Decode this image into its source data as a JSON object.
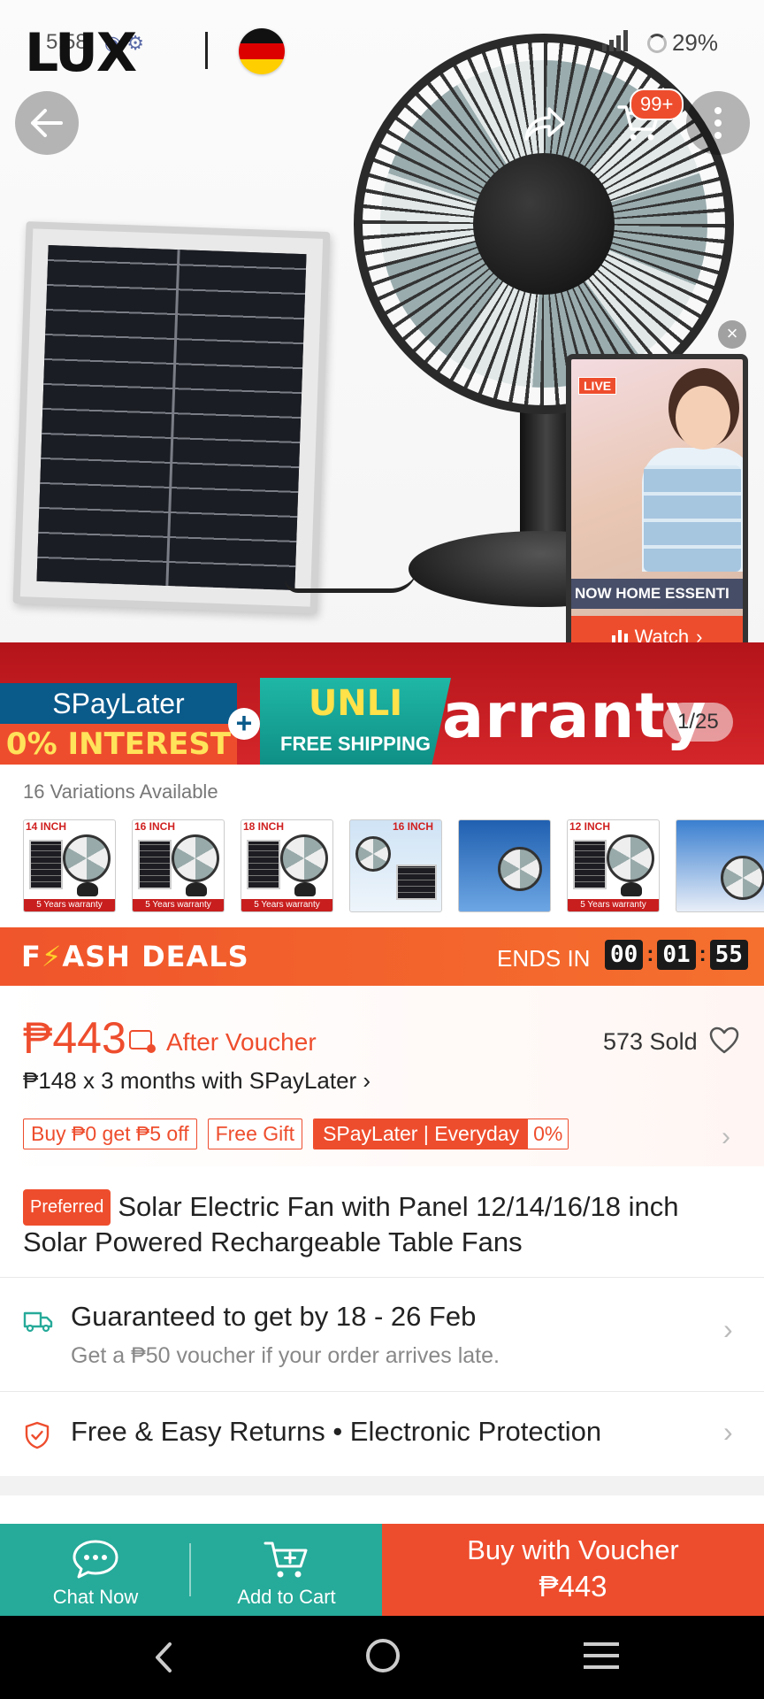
{
  "status_bar": {
    "time": "5:58",
    "battery": "29%"
  },
  "header": {
    "brand_logo": "LUX",
    "cart_badge": "99+",
    "back_icon": "arrow-left-icon",
    "share_icon": "share-icon",
    "cart_icon": "cart-icon",
    "more_icon": "more-vertical-icon"
  },
  "hero": {
    "image_counter": "1/25",
    "promo_spaylater": "SPayLater",
    "promo_interest": "0% INTEREST",
    "promo_unli": "UNLI",
    "promo_free_shipping": "FREE SHIPPING",
    "promo_warranty": "arranty"
  },
  "live": {
    "tag": "LIVE",
    "ticker": "NOW  HOME ESSENTI",
    "watch_label": "Watch"
  },
  "variations": {
    "title": "16 Variations Available",
    "thumbs": [
      {
        "label": "14 INCH",
        "footer": "5 Years warranty"
      },
      {
        "label": "16 INCH",
        "footer": "5 Years warranty"
      },
      {
        "label": "18 INCH",
        "footer": "5 Years warranty"
      },
      {
        "label": "16 INCH",
        "footer": ""
      },
      {
        "label": "",
        "footer": ""
      },
      {
        "label": "12 INCH",
        "footer": "5 Years warranty"
      },
      {
        "label": "",
        "footer": ""
      }
    ]
  },
  "flash": {
    "title_pre": "F",
    "title_post": "ASH DEALS",
    "ends_in": "ENDS IN",
    "hours": "00",
    "minutes": "01",
    "seconds": "55"
  },
  "price": {
    "amount": "₱443",
    "after_voucher": "After Voucher",
    "sold": "573 Sold",
    "installment": "₱148 x 3 months with SPayLater ›",
    "tags": [
      "Buy ₱0 get ₱5 off",
      "Free Gift"
    ],
    "spl_tag_a": "SPayLater | Everyday",
    "spl_tag_b": "0%"
  },
  "product": {
    "badge": "Preferred",
    "title": "Solar Electric Fan with Panel 12/14/16/18 inch Solar Powered Rechargeable Table Fans"
  },
  "delivery": {
    "main": "Guaranteed to get by 18 - 26 Feb",
    "sub": "Get a ₱50 voucher if your order arrives late."
  },
  "returns": {
    "text": "Free & Easy Returns  •  Electronic Protection"
  },
  "actions": {
    "chat": "Chat Now",
    "cart": "Add to Cart",
    "buy_label": "Buy with Voucher",
    "buy_price": "₱443"
  },
  "colors": {
    "brand_orange": "#ee4d2d",
    "teal": "#26aa99",
    "promo_red": "#c81e1e"
  }
}
